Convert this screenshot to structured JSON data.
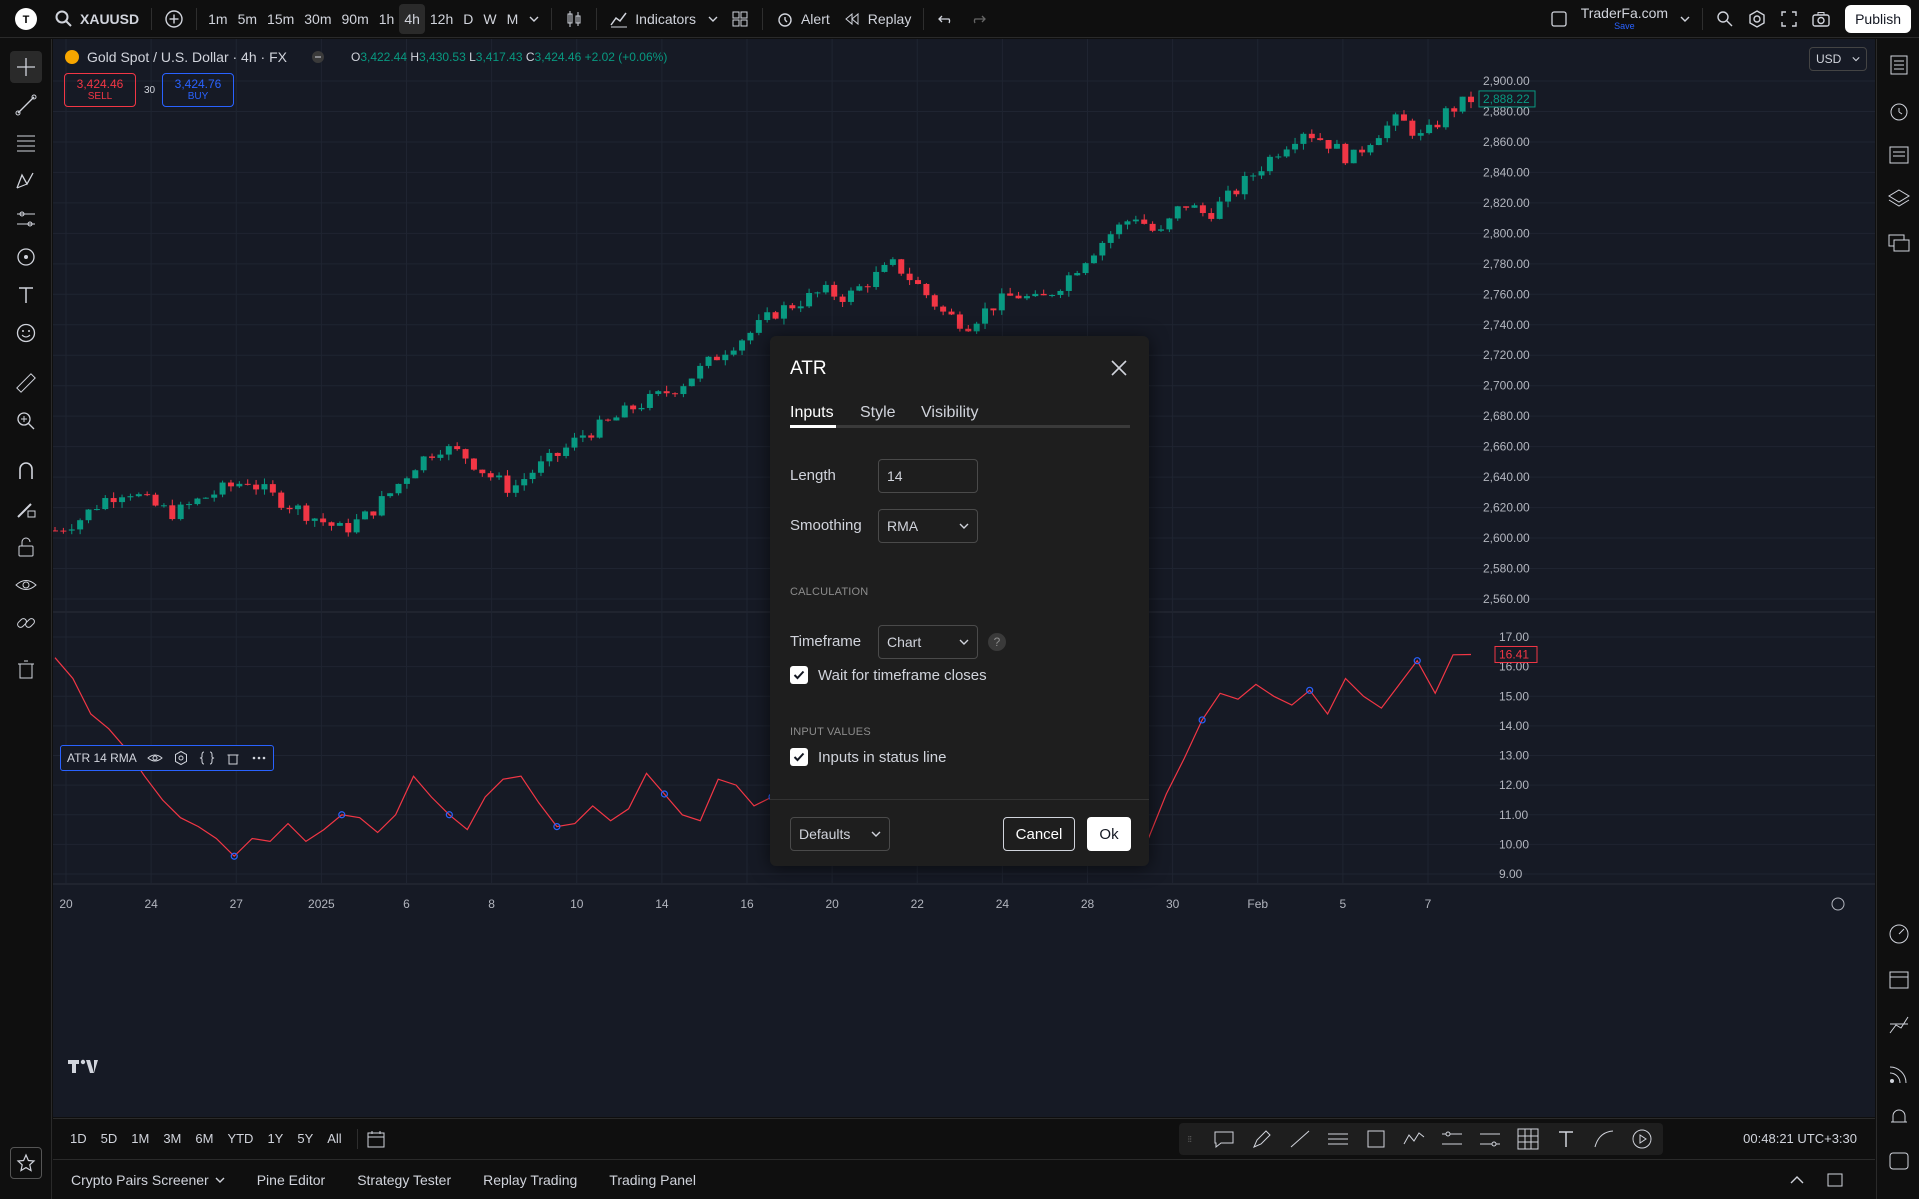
{
  "toolbar": {
    "symbol": "XAUUSD",
    "intervals": [
      "1m",
      "5m",
      "15m",
      "30m",
      "90m",
      "1h",
      "4h",
      "12h",
      "D",
      "W",
      "M"
    ],
    "active_interval": "4h",
    "indicators_label": "Indicators",
    "alert_label": "Alert",
    "replay_label": "Replay",
    "account_name": "TraderFa.com",
    "account_sub": "Save",
    "publish_label": "Publish"
  },
  "legend": {
    "title": "Gold Spot / U.S. Dollar · 4h · FX",
    "o_key": "O",
    "o": "3,422.44",
    "h_key": "H",
    "h": "3,430.53",
    "l_key": "L",
    "l": "3,417.43",
    "c_key": "C",
    "c": "3,424.46",
    "change": "+2.02 (+0.06%)"
  },
  "trade": {
    "sell_price": "3,424.46",
    "sell_label": "SELL",
    "spread": "30",
    "buy_price": "3,424.76",
    "buy_label": "BUY"
  },
  "currency": "USD",
  "indicator_legend": {
    "label": "ATR 14 RMA"
  },
  "dialog": {
    "title": "ATR",
    "tabs": [
      "Inputs",
      "Style",
      "Visibility"
    ],
    "active_tab": "Inputs",
    "length_label": "Length",
    "length_value": "14",
    "smoothing_label": "Smoothing",
    "smoothing_value": "RMA",
    "calculation_title": "CALCULATION",
    "timeframe_label": "Timeframe",
    "timeframe_value": "Chart",
    "help_glyph": "?",
    "wait_label": "Wait for timeframe closes",
    "wait_checked": true,
    "input_values_title": "INPUT VALUES",
    "status_line_label": "Inputs in status line",
    "status_line_checked": true,
    "defaults_label": "Defaults",
    "cancel_label": "Cancel",
    "ok_label": "Ok"
  },
  "ranges": [
    "1D",
    "5D",
    "1M",
    "3M",
    "6M",
    "YTD",
    "1Y",
    "5Y",
    "All"
  ],
  "clock": "00:48:21 UTC+3:30",
  "panels": [
    "Crypto Pairs Screener",
    "Pine Editor",
    "Strategy Tester",
    "Replay Trading",
    "Trading Panel"
  ],
  "colors": {
    "up": "#089981",
    "down": "#f23645",
    "accent": "#2962ff",
    "background": "#161a25"
  },
  "chart_data": [
    {
      "type": "candlestick",
      "title": "Gold Spot / U.S. Dollar · 4h · FX",
      "price_ticks": [
        "2,900.00",
        "2,880.00",
        "2,860.00",
        "2,840.00",
        "2,820.00",
        "2,800.00",
        "2,780.00",
        "2,760.00",
        "2,740.00",
        "2,720.00",
        "2,700.00",
        "2,680.00",
        "2,660.00",
        "2,640.00",
        "2,620.00",
        "2,600.00",
        "2,580.00",
        "2,560.00"
      ],
      "ylim": [
        2560,
        2900
      ],
      "last_price_label": "2,888.22",
      "close_path": [
        2605,
        2612,
        2625,
        2632,
        2622,
        2616,
        2625,
        2632,
        2638,
        2628,
        2620,
        2612,
        2605,
        2615,
        2630,
        2648,
        2660,
        2655,
        2642,
        2632,
        2645,
        2655,
        2668,
        2675,
        2685,
        2692,
        2700,
        2712,
        2725,
        2735,
        2748,
        2755,
        2762,
        2758,
        2770,
        2780,
        2765,
        2748,
        2740,
        2752,
        2760,
        2755,
        2768,
        2785,
        2800,
        2812,
        2798,
        2820,
        2812,
        2825,
        2840,
        2855,
        2868,
        2860,
        2848,
        2865,
        2875,
        2862,
        2880,
        2888
      ]
    },
    {
      "type": "line",
      "title": "ATR 14 RMA",
      "value_ticks": [
        "17.00",
        "16.00",
        "15.00",
        "14.00",
        "13.00",
        "12.00",
        "11.00",
        "10.00",
        "9.00"
      ],
      "ylim": [
        9,
        17
      ],
      "last_value_label": "16.41",
      "values": [
        16.3,
        15.6,
        14.4,
        13.9,
        13.2,
        12.3,
        11.5,
        10.9,
        10.6,
        10.2,
        9.6,
        10.2,
        10.1,
        10.7,
        10.1,
        10.5,
        11.0,
        10.9,
        10.4,
        11.0,
        12.3,
        11.6,
        11.0,
        10.5,
        11.6,
        12.2,
        12.3,
        11.4,
        10.6,
        10.7,
        11.3,
        10.8,
        11.2,
        12.4,
        11.7,
        11.0,
        10.8,
        12.2,
        12.0,
        11.3,
        11.6,
        11.5,
        12.0,
        11.2,
        10.9,
        12.3,
        11.7,
        11.3,
        11.6,
        11.0,
        11.3,
        11.0,
        13.5,
        14.2,
        13.0,
        12.6,
        11.2,
        10.9,
        10.6,
        11.1,
        10.4,
        10.2,
        11.7,
        12.9,
        14.2,
        15.1,
        14.9,
        15.4,
        15.0,
        14.7,
        15.2,
        14.4,
        15.6,
        15.0,
        14.6,
        15.4,
        16.2,
        15.1,
        16.4,
        16.41
      ],
      "markers_every": 6,
      "xlabel": "",
      "ylabel": ""
    }
  ],
  "time_axis": [
    "20",
    "24",
    "27",
    "2025",
    "6",
    "8",
    "10",
    "14",
    "16",
    "20",
    "22",
    "24",
    "28",
    "30",
    "Feb",
    "5",
    "7"
  ]
}
